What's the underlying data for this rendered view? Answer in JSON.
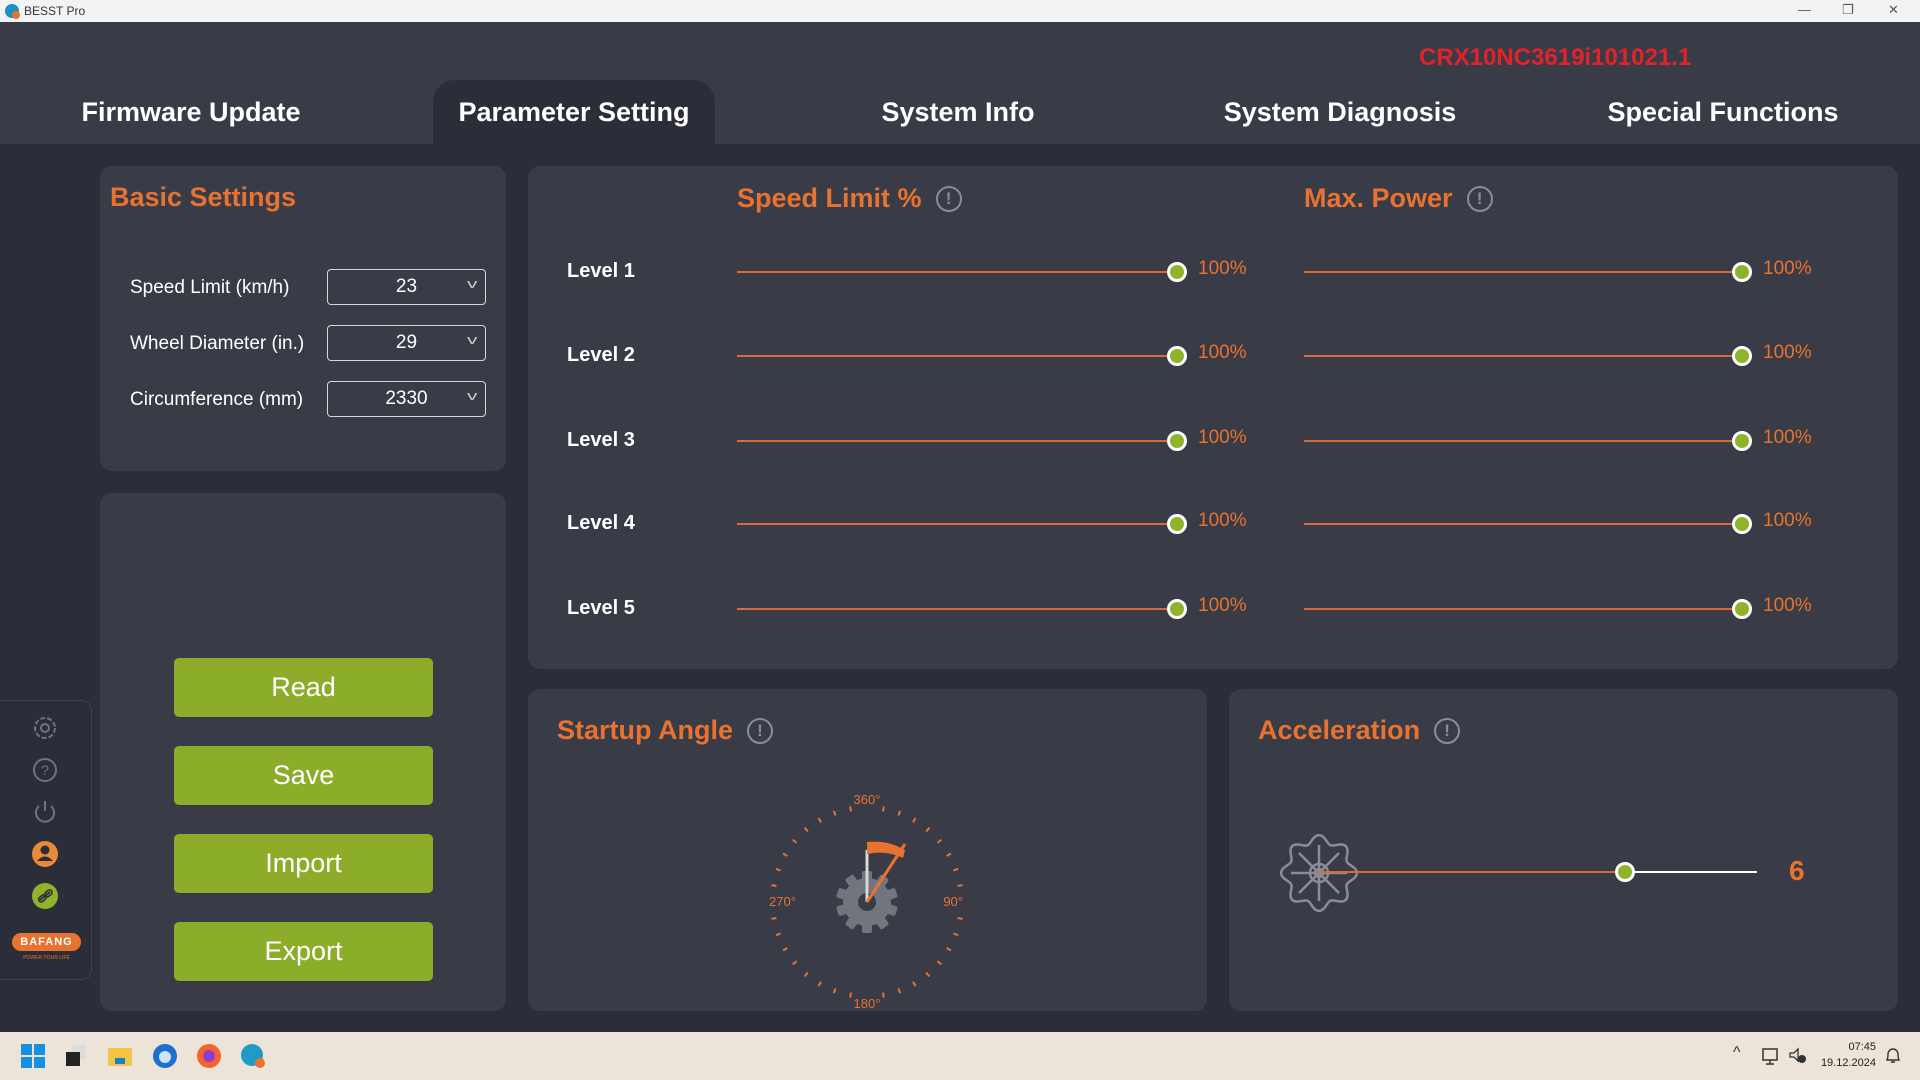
{
  "window": {
    "title": "BESST Pro"
  },
  "tabs": [
    {
      "label": "Firmware Update",
      "active": false
    },
    {
      "label": "Parameter Setting",
      "active": true
    },
    {
      "label": "System Info",
      "active": false
    },
    {
      "label": "System Diagnosis",
      "active": false
    },
    {
      "label": "Special Functions",
      "active": false
    }
  ],
  "serial_number": "CRX10NC3619i101021.1",
  "basic_settings": {
    "title": "Basic Settings",
    "fields": [
      {
        "label": "Speed Limit (km/h)",
        "value": "23"
      },
      {
        "label": "Wheel Diameter (in.)",
        "value": "29"
      },
      {
        "label": "Circumference (mm)",
        "value": "2330"
      }
    ]
  },
  "actions": {
    "read": "Read",
    "save": "Save",
    "import": "Import",
    "export": "Export"
  },
  "levels": {
    "speed_limit_title": "Speed Limit %",
    "max_power_title": "Max. Power",
    "rows": [
      {
        "label": "Level 1",
        "speed_limit": 100,
        "speed_limit_text": "100%",
        "max_power": 100,
        "max_power_text": "100%"
      },
      {
        "label": "Level 2",
        "speed_limit": 100,
        "speed_limit_text": "100%",
        "max_power": 100,
        "max_power_text": "100%"
      },
      {
        "label": "Level 3",
        "speed_limit": 100,
        "speed_limit_text": "100%",
        "max_power": 100,
        "max_power_text": "100%"
      },
      {
        "label": "Level 4",
        "speed_limit": 100,
        "speed_limit_text": "100%",
        "max_power": 100,
        "max_power_text": "100%"
      },
      {
        "label": "Level 5",
        "speed_limit": 100,
        "speed_limit_text": "100%",
        "max_power": 100,
        "max_power_text": "100%"
      }
    ]
  },
  "startup_angle": {
    "title": "Startup Angle",
    "dial_labels": {
      "top": "360°",
      "right": "90°",
      "bottom": "180°",
      "left": "270°"
    }
  },
  "acceleration": {
    "title": "Acceleration",
    "value": "6",
    "slider_fraction": 0.7
  },
  "sidebar_icons": [
    "gear-icon",
    "help-icon",
    "power-icon",
    "user-icon",
    "link-icon"
  ],
  "brand": {
    "logo_text": "BAFANG",
    "tagline": "POWER YOUR LIFE"
  },
  "taskbar": {
    "time": "07:45",
    "date": "19.12.2024"
  },
  "colors": {
    "accent": "#e8722f",
    "button": "#8cad2a",
    "serial": "#e3212b",
    "panel": "#393c47",
    "background": "#2b2e38"
  }
}
